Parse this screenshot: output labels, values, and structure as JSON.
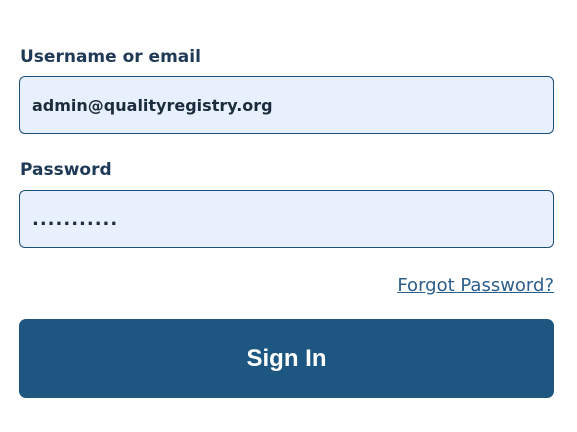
{
  "form": {
    "username_label": "Username or email",
    "username_value": "admin@qualityregistry.org",
    "password_label": "Password",
    "password_value": "...........",
    "forgot_password_label": "Forgot Password?",
    "sign_in_label": "Sign In"
  },
  "colors": {
    "accent": "#1d5781",
    "input_background": "#e8f0fe",
    "input_border": "#1c4f7a",
    "link": "#2d5d8a"
  }
}
